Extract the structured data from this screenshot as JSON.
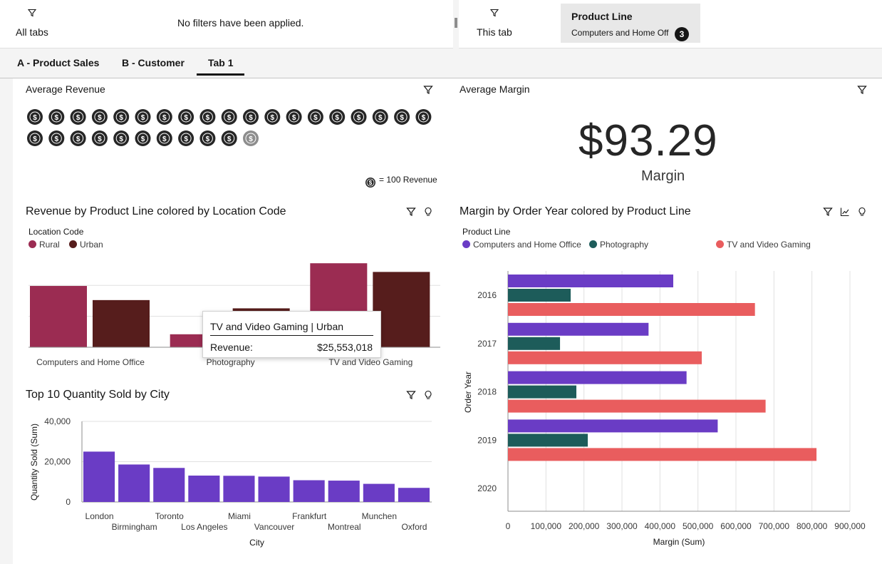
{
  "filter_bar": {
    "all_tabs_label": "All tabs",
    "no_filters_text": "No filters have been applied.",
    "this_tab_label": "This tab",
    "chip": {
      "title": "Product Line",
      "value": "Computers and Home Off",
      "count": "3"
    }
  },
  "tabs": [
    {
      "label": "A - Product Sales",
      "selected": false
    },
    {
      "label": "B - Customer",
      "selected": false
    },
    {
      "label": "Tab 1",
      "selected": true
    }
  ],
  "colors": {
    "rural": "#9b2c52",
    "urban": "#561d1c",
    "computers": "#6a3cc5",
    "photography": "#1d5c5a",
    "tv": "#e95d5e",
    "quantity": "#6a3cc5"
  },
  "widgets": {
    "avg_revenue": {
      "title": "Average Revenue",
      "icon_glyph": "$",
      "icon_count": 29.5,
      "legend_text": "= 100 Revenue"
    },
    "avg_margin": {
      "title": "Average Margin",
      "value": "$93.29",
      "label": "Margin"
    },
    "revenue_chart": {
      "title": "Revenue by Product Line colored by Location Code",
      "legend_title": "Location Code",
      "tooltip": {
        "header": "TV and Video Gaming | Urban",
        "key": "Revenue:",
        "value": "$25,553,018"
      }
    },
    "quantity_chart": {
      "title": "Top 10 Quantity Sold by City"
    },
    "margin_chart": {
      "title": "Margin by Order Year colored by Product Line",
      "legend_title": "Product Line"
    }
  },
  "chart_data": [
    {
      "id": "revenue",
      "type": "bar",
      "title": "Revenue by Product Line colored by Location Code",
      "categories": [
        "Computers and Home Office",
        "Photography",
        "TV and Video Gaming"
      ],
      "series": [
        {
          "name": "Rural",
          "values": [
            20800000,
            4400000,
            28500000
          ]
        },
        {
          "name": "Urban",
          "values": [
            16000000,
            13200000,
            25553018
          ]
        }
      ],
      "ylim": [
        0,
        30000000
      ],
      "grid": true,
      "legend": "top-left"
    },
    {
      "id": "quantity",
      "type": "bar",
      "title": "Top 10 Quantity Sold by City",
      "xlabel": "City",
      "ylabel": "Quantity Sold (Sum)",
      "categories": [
        "London",
        "Birmingham",
        "Toronto",
        "Los Angeles",
        "Miami",
        "Vancouver",
        "Frankfurt",
        "Montreal",
        "Munchen",
        "Oxford"
      ],
      "values": [
        25000,
        18600,
        16900,
        13100,
        13000,
        12600,
        10800,
        10600,
        9000,
        7000
      ],
      "yticks": [
        "0",
        "20,000",
        "40,000"
      ],
      "ylim": [
        0,
        40000
      ],
      "grid": true
    },
    {
      "id": "margin",
      "type": "bar",
      "title": "Margin by Order Year colored by Product Line",
      "xlabel": "Margin (Sum)",
      "ylabel": "Order Year",
      "categories": [
        "2016",
        "2017",
        "2018",
        "2019",
        "2020"
      ],
      "series": [
        {
          "name": "Computers and Home Office",
          "values": [
            435000,
            370000,
            470000,
            552000,
            null
          ]
        },
        {
          "name": "Photography",
          "values": [
            165000,
            137000,
            180000,
            210000,
            null
          ]
        },
        {
          "name": "TV and Video Gaming",
          "values": [
            650000,
            510000,
            678000,
            812000,
            null
          ]
        }
      ],
      "xticks": [
        "0",
        "100,000",
        "200,000",
        "300,000",
        "400,000",
        "500,000",
        "600,000",
        "700,000",
        "800,000",
        "900,000"
      ],
      "xlim": [
        0,
        900000
      ],
      "grid": true,
      "legend": "top-left"
    }
  ]
}
